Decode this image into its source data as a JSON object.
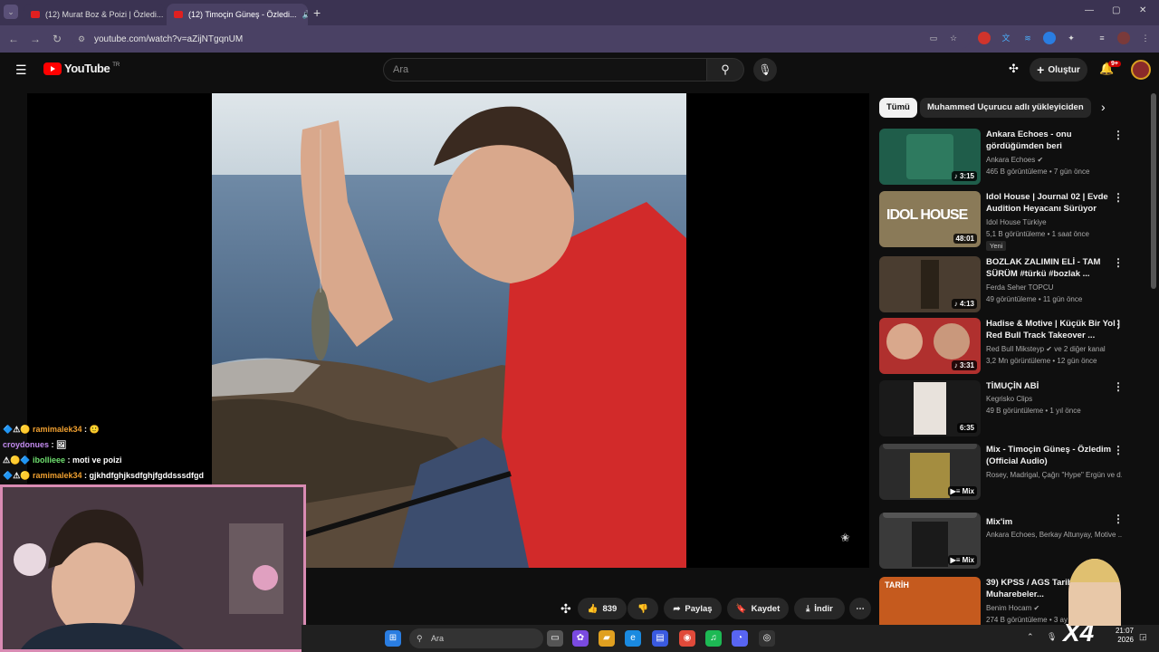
{
  "browser": {
    "tabs": [
      {
        "label": "(12) Murat Boz & Poizi | Özledi..."
      },
      {
        "label": "(12) Timoçin Güneş - Özledi..."
      }
    ],
    "new_tab": "+",
    "url": "youtube.com/watch?v=aZijNTgqnUM"
  },
  "youtube": {
    "logo_text": "YouTube",
    "region": "TR",
    "search_placeholder": "Ara",
    "create_label": "Oluştur",
    "notif_count": "9+"
  },
  "chips": [
    {
      "label": "Tümü"
    },
    {
      "label": "Muhammed Uçurucu adlı yükleyiciden"
    }
  ],
  "recommendations": [
    {
      "title": "Ankara Echoes - onu gördüğümden beri",
      "channel": "Ankara Echoes",
      "meta": "465 B görüntüleme • 7 gün önce",
      "duration": "3:15",
      "thumb_color": "#1f5d4a"
    },
    {
      "title": "Idol House | Journal 02 | Evde Audition Heyacanı Sürüyor",
      "channel": "Idol House Türkiye",
      "meta": "5,1 B görüntüleme • 1 saat önce",
      "duration": "48:01",
      "badge": "Yeni",
      "thumb_color": "#8a7a58"
    },
    {
      "title": "BOZLAK ZALIMIN ELİ - TAM SÜRÜM #türkü #bozlak ...",
      "channel": "Ferda Seher TOPCU",
      "meta": "49 görüntüleme • 11 gün önce",
      "duration": "4:13",
      "thumb_color": "#4a3d30"
    },
    {
      "title": "Hadise & Motive | Küçük Bir Yol | Red Bull Track Takeover ...",
      "channel": "Red Bull Miksteyp",
      "channel_extra": "ve 2 diğer kanal",
      "meta": "3,2 Mn görüntüleme • 12 gün önce",
      "duration": "3:31",
      "thumb_color": "#b0302e"
    },
    {
      "title": "TİMUÇİN ABİ",
      "channel": "Kegrisko Clips",
      "meta": "49 B görüntüleme • 1 yıl önce",
      "duration": "6:35",
      "thumb_color": "#1a1a1a"
    },
    {
      "title": "Mix - Timoçin Güneş - Özledim (Official Audio)",
      "channel": "Rosey, Madrigal, Çağrı \"Hype\" Ergün ve d...",
      "meta": "",
      "duration": "Mix",
      "thumb_color": "#2b2b2b"
    },
    {
      "title": "Mix'im",
      "channel": "Ankara Echoes, Berkay Altunyay, Motive ...",
      "meta": "",
      "duration": "Mix",
      "thumb_color": "#3a3a3a"
    },
    {
      "title": "39) KPSS / AGS Tarih - Mücadele Muharebeler...",
      "channel": "Benim Hocam",
      "meta": "274 B görüntüleme • 3 ay önce",
      "duration": "",
      "thumb_color": "#c55a1e"
    }
  ],
  "actions": {
    "likes": "839",
    "share": "Paylaş",
    "save": "Kaydet",
    "download": "İndir"
  },
  "chat": [
    {
      "user": "ramimalek34",
      "msg": ":",
      "color": "#f0a030"
    },
    {
      "user": "croydonues",
      "msg": ":",
      "color": "#c38bf0"
    },
    {
      "user": "ibollieee",
      "msg": ": moti ve poizi",
      "color": "#6fe06f"
    },
    {
      "user": "ramimalek34",
      "msg": ": gjkhdfghjksdfghjfgddsssdfgd",
      "color": "#f0a030"
    }
  ],
  "taskbar": {
    "search_placeholder": "Ara",
    "time": "21:07",
    "date": "2026",
    "overlay_text": "X4"
  }
}
